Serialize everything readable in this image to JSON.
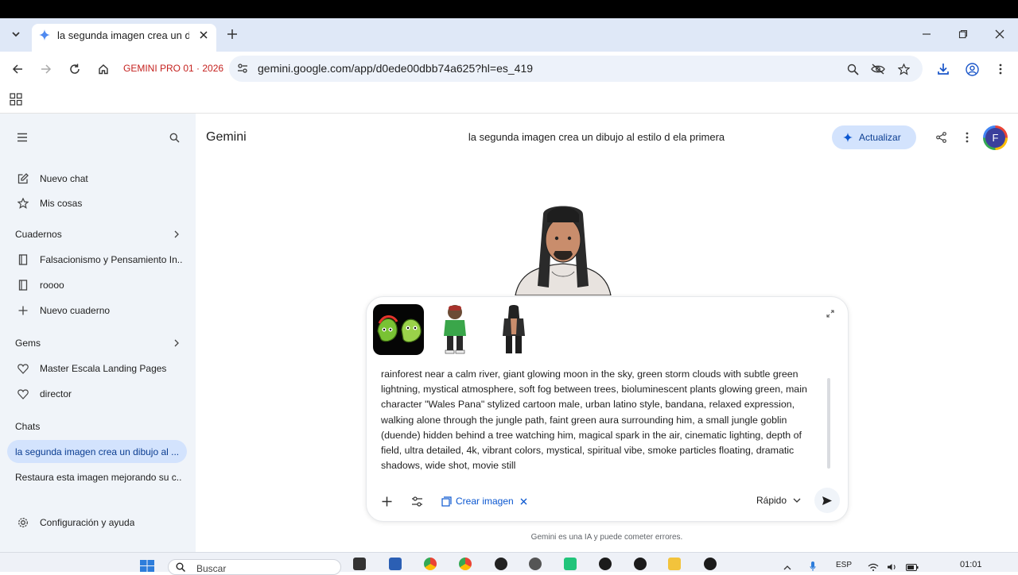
{
  "browser": {
    "tab_title": "la segunda imagen crea un dibujo al estilo d ela primera",
    "bookmark_label": "GEMINI PRO 01 · 2026",
    "url": "gemini.google.com/app/d0ede00dbb74a625?hl=es_419"
  },
  "header": {
    "app_name": "Gemini",
    "chat_title": "la segunda imagen crea un dibujo al estilo d ela primera",
    "upgrade_label": "Actualizar",
    "avatar_initial": "F"
  },
  "sidebar": {
    "top_items": [
      {
        "label": "Nuevo chat",
        "icon": "edit-icon"
      },
      {
        "label": "Mis cosas",
        "icon": "shapes-icon"
      }
    ],
    "notebooks_heading": "Cuadernos",
    "notebooks": [
      {
        "label": "Falsacionismo y Pensamiento In...",
        "icon": "notebook-icon"
      },
      {
        "label": "roooo",
        "icon": "notebook-icon"
      },
      {
        "label": "Nuevo cuaderno",
        "icon": "plus-icon"
      }
    ],
    "gems_heading": "Gems",
    "gems": [
      {
        "label": "Master Escala Landing Pages",
        "icon": "gem-icon"
      },
      {
        "label": "director",
        "icon": "gem-icon"
      }
    ],
    "chats_heading": "Chats",
    "chats": [
      {
        "label": "la segunda imagen crea un dibujo al ...",
        "active": true
      },
      {
        "label": "Restaura esta imagen mejorando su c...",
        "active": false
      }
    ],
    "settings_label": "Configuración y ayuda"
  },
  "prompt": {
    "text": "rainforest near a calm river, giant glowing moon in the sky, green storm clouds with subtle green lightning, mystical atmosphere, soft fog between trees, bioluminescent plants glowing green, main character \"Wales Pana\" stylized cartoon male, urban latino style, bandana, relaxed expression, walking alone through the jungle path, faint green aura surrounding him, a small jungle goblin (duende) hidden behind a tree watching him, magical spark in the air, cinematic lighting, depth of field, ultra detailed, 4k, vibrant colors, mystical, spiritual vibe, smoke particles floating, dramatic shadows, wide shot, movie still",
    "tool_chip": "Crear imagen",
    "mode_label": "Rápido"
  },
  "footer": {
    "disclaimer": "Gemini es una IA y puede cometer errores."
  },
  "taskbar": {
    "search_placeholder": "Buscar",
    "language": "ESP",
    "time": "01:01"
  },
  "colors": {
    "accent": "#0b57d0",
    "sidebar_bg": "#f0f4f9",
    "active_chat_bg": "#d3e3fd",
    "bookmark_red": "#c5221f"
  }
}
